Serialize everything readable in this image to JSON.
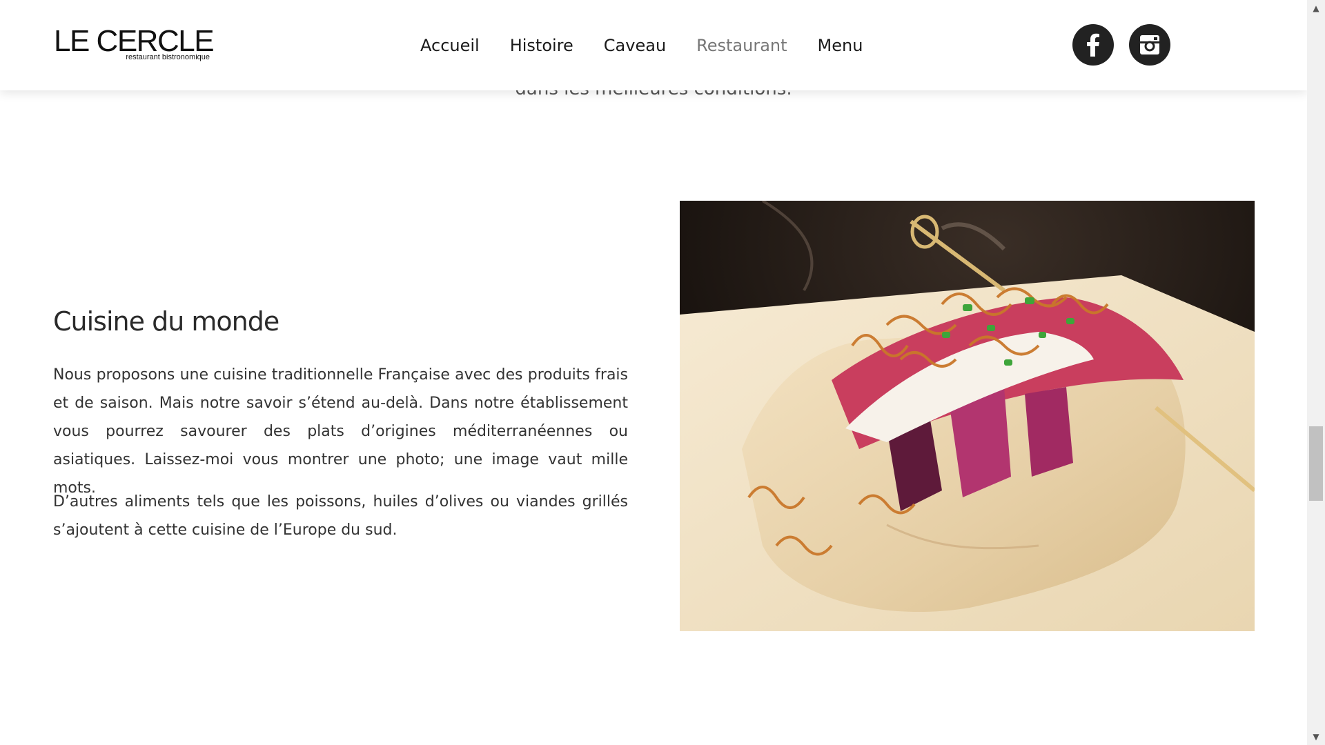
{
  "header": {
    "logo": {
      "title": "LE CERCLE",
      "subtitle": "restaurant bistronomique"
    },
    "nav": [
      {
        "label": "Accueil",
        "active": false
      },
      {
        "label": "Histoire",
        "active": false
      },
      {
        "label": "Caveau",
        "active": false
      },
      {
        "label": "Restaurant",
        "active": true
      },
      {
        "label": "Menu",
        "active": false
      }
    ],
    "social": [
      {
        "icon": "facebook-icon",
        "color": "#222222"
      },
      {
        "icon": "instagram-icon",
        "color": "#222222"
      }
    ]
  },
  "intro": {
    "cut_text": "dans les meilleures conditions."
  },
  "section": {
    "title": "Cuisine du monde",
    "paragraphs": [
      "Nous proposons une cuisine traditionnelle Française avec des produits frais et de saison. Mais notre savoir s’étend au-delà. Dans notre établissement vous pourrez savourer des plats d’origines méditerranéennes ou asiatiques. Laissez-moi vous montrer une photo; une image vaut mille mots.",
      "D’autres aliments tels que les poissons, huiles d’olives ou viandes grillés s’ajoutent à cette cuisine de l’Europe du sud."
    ],
    "image": {
      "subject": "taco-photo"
    }
  },
  "scrollbar": {
    "up_arrow": "▲",
    "down_arrow": "▼"
  },
  "colors": {
    "nav_active": "#777777",
    "text": "#333333",
    "social_bg": "#222222"
  }
}
